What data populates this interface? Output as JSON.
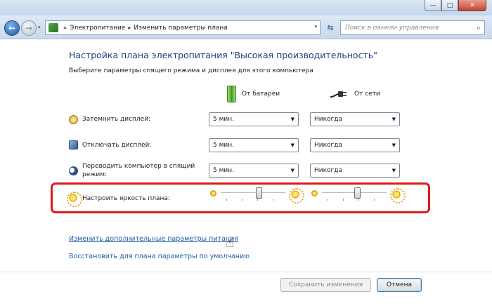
{
  "window": {
    "minimize_glyph": "—",
    "maximize_glyph": "□",
    "close_glyph": "✕"
  },
  "navbar": {
    "breadcrumb": [
      {
        "label": "Электропитание"
      },
      {
        "label": "Изменить параметры плана"
      }
    ],
    "breadcrumb_separator": "«",
    "breadcrumb_arrow": "▸",
    "search_placeholder": "Поиск в панели управления",
    "icons": {
      "back": "back-arrow-icon",
      "forward": "forward-arrow-icon",
      "refresh": "refresh-icon",
      "search": "search-icon"
    }
  },
  "plan": {
    "title": "Настройка плана электропитания \"Высокая производительность\"",
    "subtitle": "Выберите параметры спящего режима и дисплея для этого компьютера",
    "columns": {
      "battery": "От батареи",
      "ac": "От сети"
    },
    "settings": [
      {
        "label": "Затемнить дисплей:",
        "battery": "5 мин.",
        "ac": "Никогда",
        "icon": "dim-display-icon"
      },
      {
        "label": "Отключать дисплей:",
        "battery": "5 мин.",
        "ac": "Никогда",
        "icon": "monitor-icon"
      },
      {
        "label": "Переводить компьютер в спящий режим:",
        "battery": "5 мин.",
        "ac": "Никогда",
        "icon": "sleep-moon-icon"
      }
    ],
    "brightness": {
      "label": "Настроить яркость плана:",
      "battery_level": 0.6,
      "ac_level": 0.55
    }
  },
  "links": {
    "advanced": "Изменить дополнительные параметры питания",
    "restore": "Восстановить для плана параметры по умолчанию"
  },
  "buttons": {
    "save": "Сохранить изменения",
    "cancel": "Отмена"
  },
  "colors": {
    "title": "#1e3f7a",
    "link": "#1f5ca8",
    "highlight": "#e01818"
  }
}
